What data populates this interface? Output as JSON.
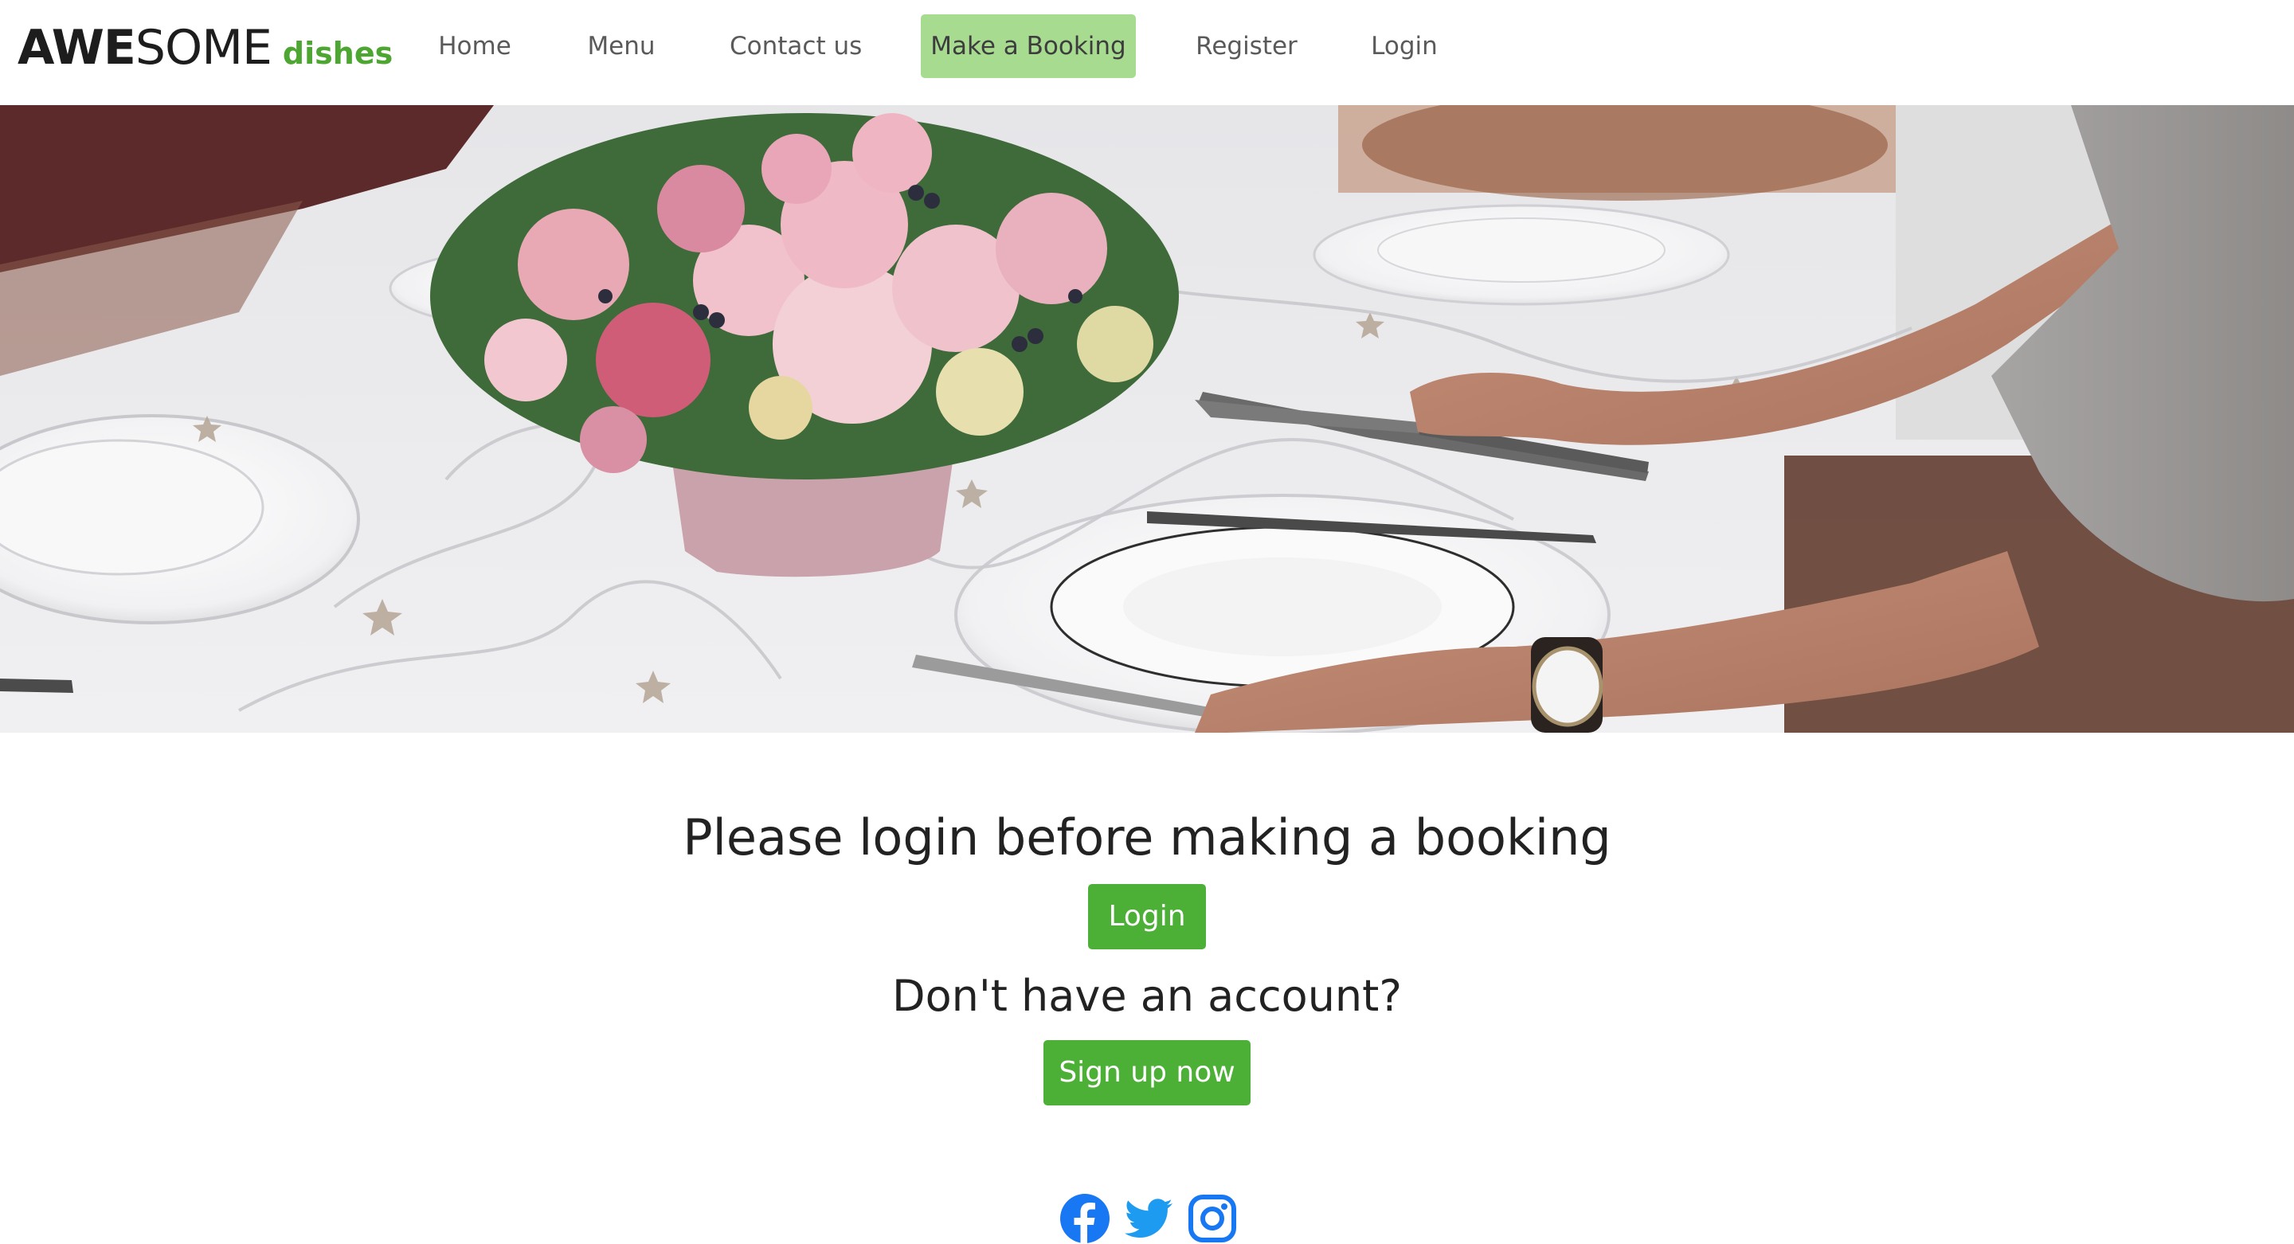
{
  "brand": {
    "main_bold": "AWE",
    "main_light": "SOME",
    "sub": "dishes"
  },
  "nav": {
    "items": [
      {
        "label": "Home"
      },
      {
        "label": "Menu"
      },
      {
        "label": "Contact us"
      },
      {
        "label": "Make a Booking",
        "active": true
      },
      {
        "label": "Register"
      },
      {
        "label": "Login"
      }
    ]
  },
  "hero": {
    "icon": "table-setting-photo"
  },
  "main": {
    "login_prompt": "Please login before making a booking",
    "login_button": "Login",
    "account_prompt": "Don't have an account?",
    "signup_button": "Sign up now"
  },
  "social": {
    "icons": [
      "facebook-icon",
      "twitter-icon",
      "instagram-icon"
    ],
    "color": "#1877f2"
  },
  "colors": {
    "accent": "#4caf36",
    "active_nav": "#a6db90",
    "brand_green": "#4ca631"
  }
}
